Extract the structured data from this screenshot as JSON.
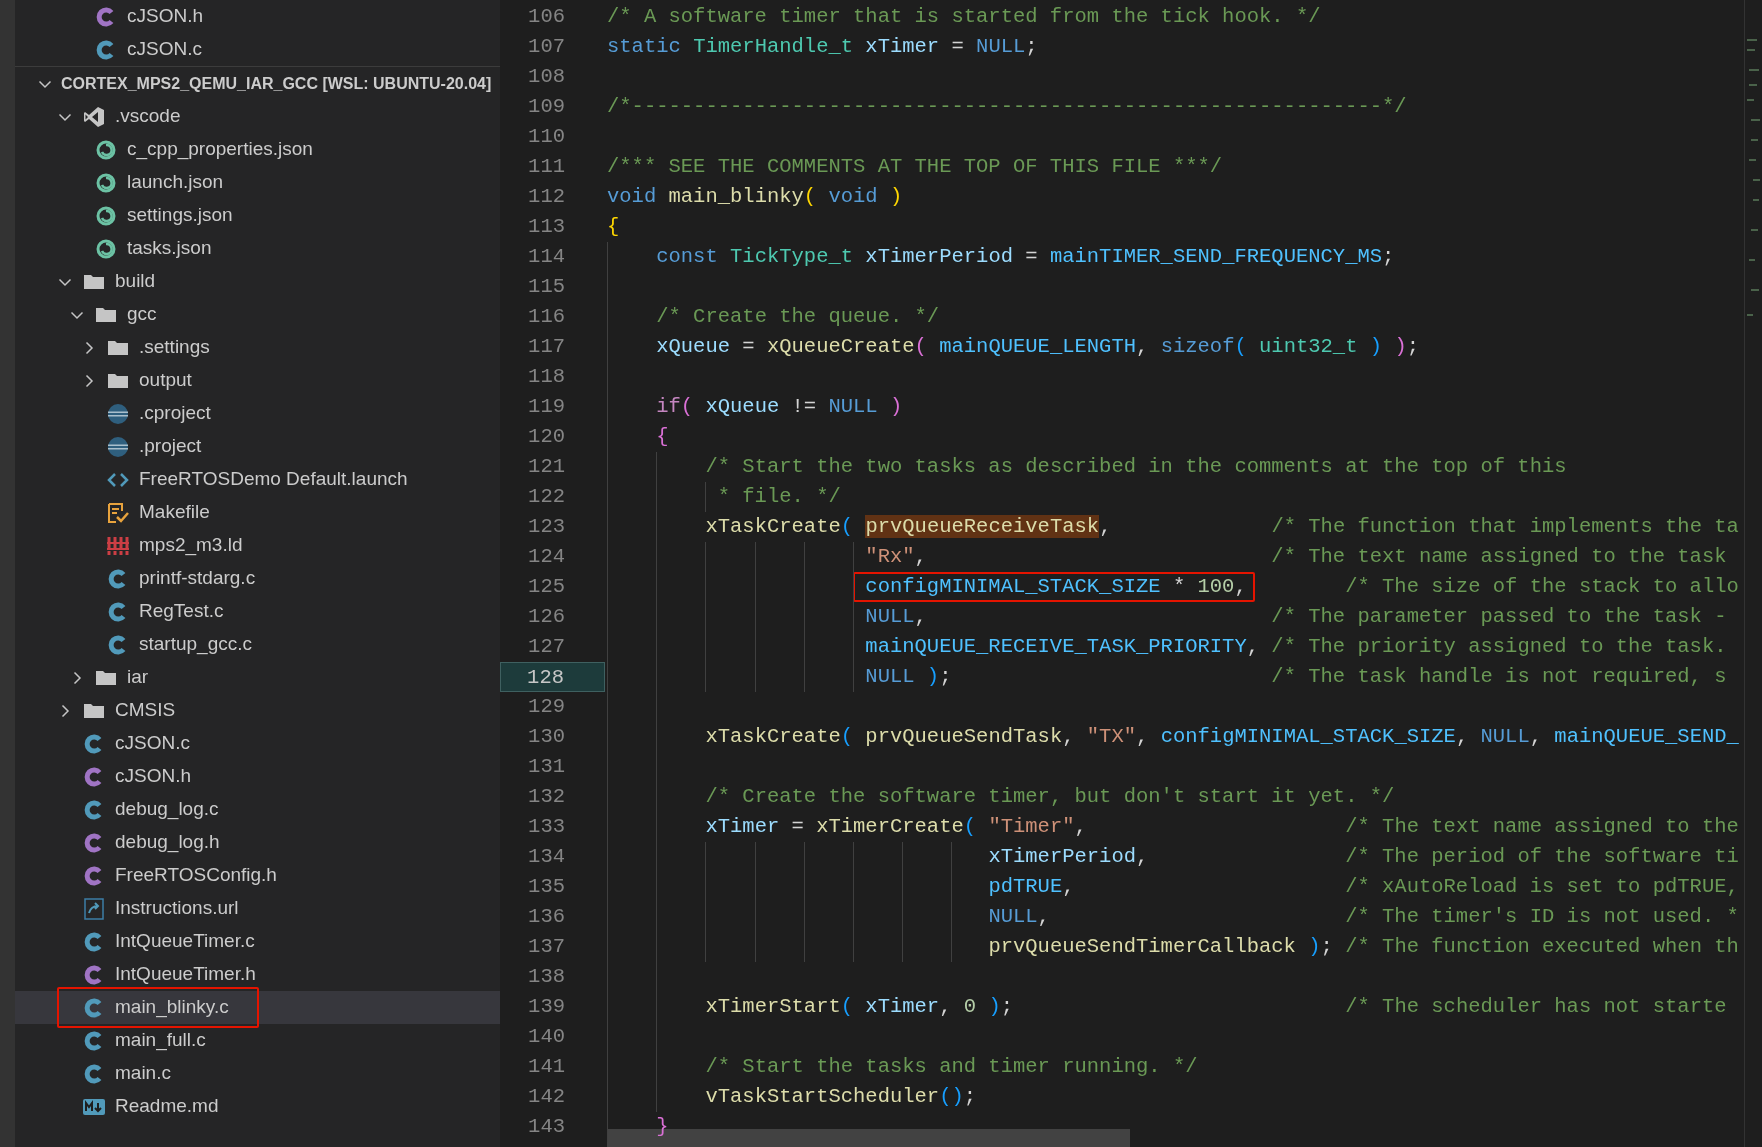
{
  "explorer": {
    "previous_items": [
      {
        "label": "cJSON.h",
        "kind": "c-header",
        "selected": false,
        "outlined": false
      },
      {
        "label": "cJSON.c",
        "kind": "c-source",
        "selected": false,
        "outlined": false
      }
    ],
    "workspace": {
      "title": "CORTEX_MPS2_QEMU_IAR_GCC [WSL: UBUNTU-20.04]",
      "expanded": true,
      "children": [
        {
          "label": ".vscode",
          "kind": "vscode",
          "expanded": true,
          "selected": false,
          "outlined": false,
          "children": [
            {
              "label": "c_cpp_properties.json",
              "kind": "json",
              "selected": false,
              "outlined": false
            },
            {
              "label": "launch.json",
              "kind": "json",
              "selected": false,
              "outlined": false
            },
            {
              "label": "settings.json",
              "kind": "json",
              "selected": false,
              "outlined": false
            },
            {
              "label": "tasks.json",
              "kind": "json",
              "selected": false,
              "outlined": false
            }
          ]
        },
        {
          "label": "build",
          "kind": "folder",
          "expanded": true,
          "selected": false,
          "outlined": false,
          "children": [
            {
              "label": "gcc",
              "kind": "folder",
              "expanded": true,
              "selected": false,
              "outlined": false,
              "children": [
                {
                  "label": ".settings",
                  "kind": "folder",
                  "expanded": false,
                  "selected": false,
                  "outlined": false
                },
                {
                  "label": "output",
                  "kind": "folder",
                  "expanded": false,
                  "selected": false,
                  "outlined": false
                },
                {
                  "label": ".cproject",
                  "kind": "eclipse",
                  "selected": false,
                  "outlined": false
                },
                {
                  "label": ".project",
                  "kind": "eclipse",
                  "selected": false,
                  "outlined": false
                },
                {
                  "label": "FreeRTOSDemo Default.launch",
                  "kind": "launch",
                  "selected": false,
                  "outlined": false
                },
                {
                  "label": "Makefile",
                  "kind": "makefile",
                  "selected": false,
                  "outlined": false
                },
                {
                  "label": "mps2_m3.ld",
                  "kind": "linker",
                  "selected": false,
                  "outlined": false
                },
                {
                  "label": "printf-stdarg.c",
                  "kind": "c-source",
                  "selected": false,
                  "outlined": false
                },
                {
                  "label": "RegTest.c",
                  "kind": "c-source",
                  "selected": false,
                  "outlined": false
                },
                {
                  "label": "startup_gcc.c",
                  "kind": "c-source",
                  "selected": false,
                  "outlined": false
                }
              ]
            },
            {
              "label": "iar",
              "kind": "folder",
              "expanded": false,
              "selected": false,
              "outlined": false
            }
          ]
        },
        {
          "label": "CMSIS",
          "kind": "folder",
          "expanded": false,
          "selected": false,
          "outlined": false
        },
        {
          "label": "cJSON.c",
          "kind": "c-source",
          "selected": false,
          "outlined": false
        },
        {
          "label": "cJSON.h",
          "kind": "c-header",
          "selected": false,
          "outlined": false
        },
        {
          "label": "debug_log.c",
          "kind": "c-source",
          "selected": false,
          "outlined": false
        },
        {
          "label": "debug_log.h",
          "kind": "c-header",
          "selected": false,
          "outlined": false
        },
        {
          "label": "FreeRTOSConfig.h",
          "kind": "c-header",
          "selected": false,
          "outlined": false
        },
        {
          "label": "Instructions.url",
          "kind": "url",
          "selected": false,
          "outlined": false
        },
        {
          "label": "IntQueueTimer.c",
          "kind": "c-source",
          "selected": false,
          "outlined": false
        },
        {
          "label": "IntQueueTimer.h",
          "kind": "c-header",
          "selected": false,
          "outlined": false
        },
        {
          "label": "main_blinky.c",
          "kind": "c-source",
          "selected": true,
          "outlined": true
        },
        {
          "label": "main_full.c",
          "kind": "c-source",
          "selected": false,
          "outlined": false
        },
        {
          "label": "main.c",
          "kind": "c-source",
          "selected": false,
          "outlined": false
        },
        {
          "label": "Readme.md",
          "kind": "markdown",
          "selected": false,
          "outlined": false
        }
      ]
    }
  },
  "editor": {
    "lines": [
      {
        "number": "106",
        "current": false,
        "tokens": [
          {
            "text": "/* A software timer that is started from the tick hook. */",
            "kind": "comment"
          }
        ]
      },
      {
        "number": "107",
        "current": false,
        "tokens": [
          {
            "text": "static ",
            "kind": "keyword"
          },
          {
            "text": "TimerHandle_t ",
            "kind": "type"
          },
          {
            "text": "xTimer ",
            "kind": "variable"
          },
          {
            "text": "= ",
            "kind": "punct"
          },
          {
            "text": "NULL",
            "kind": "keyword"
          },
          {
            "text": ";",
            "kind": "punct"
          }
        ]
      },
      {
        "number": "108",
        "current": false
      },
      {
        "number": "109",
        "current": false,
        "tokens": [
          {
            "text": "/*-------------------------------------------------------------*/",
            "kind": "comment"
          }
        ]
      },
      {
        "number": "110",
        "current": false
      },
      {
        "number": "111",
        "current": false,
        "tokens": [
          {
            "text": "/*** SEE THE COMMENTS AT THE TOP OF THIS FILE ***/",
            "kind": "comment"
          }
        ]
      },
      {
        "number": "112",
        "current": false,
        "tokens": [
          {
            "text": "void ",
            "kind": "keyword"
          },
          {
            "text": "main_blinky",
            "kind": "function"
          },
          {
            "text": "( ",
            "kind": "bracket1"
          },
          {
            "text": "void ",
            "kind": "keyword"
          },
          {
            "text": ")",
            "kind": "bracket1"
          }
        ]
      },
      {
        "number": "113",
        "current": false,
        "tokens": [
          {
            "text": "{",
            "kind": "bracket1"
          }
        ]
      },
      {
        "number": "114",
        "current": false,
        "tokens": [
          {
            "text": "    const ",
            "kind": "keyword"
          },
          {
            "text": "TickType_t ",
            "kind": "type"
          },
          {
            "text": "xTimerPeriod ",
            "kind": "variable"
          },
          {
            "text": "= ",
            "kind": "punct"
          },
          {
            "text": "mainTIMER_SEND_FREQUENCY_MS",
            "kind": "macro"
          },
          {
            "text": ";",
            "kind": "punct"
          }
        ]
      },
      {
        "number": "115",
        "current": false
      },
      {
        "number": "116",
        "current": false,
        "tokens": [
          {
            "text": "    /* Create the queue. */",
            "kind": "comment"
          }
        ]
      },
      {
        "number": "117",
        "current": false,
        "tokens": [
          {
            "text": "    xQueue ",
            "kind": "variable"
          },
          {
            "text": "= ",
            "kind": "punct"
          },
          {
            "text": "xQueueCreate",
            "kind": "function"
          },
          {
            "text": "( ",
            "kind": "bracket2"
          },
          {
            "text": "mainQUEUE_LENGTH",
            "kind": "macro"
          },
          {
            "text": ", ",
            "kind": "punct"
          },
          {
            "text": "sizeof",
            "kind": "keyword"
          },
          {
            "text": "( ",
            "kind": "bracket3"
          },
          {
            "text": "uint32_t ",
            "kind": "type"
          },
          {
            "text": ") ",
            "kind": "bracket3"
          },
          {
            "text": ")",
            "kind": "bracket2"
          },
          {
            "text": ";",
            "kind": "punct"
          }
        ]
      },
      {
        "number": "118",
        "current": false
      },
      {
        "number": "119",
        "current": false,
        "tokens": [
          {
            "text": "    if",
            "kind": "control"
          },
          {
            "text": "( ",
            "kind": "bracket2"
          },
          {
            "text": "xQueue ",
            "kind": "variable"
          },
          {
            "text": "!= ",
            "kind": "punct"
          },
          {
            "text": "NULL ",
            "kind": "keyword"
          },
          {
            "text": ")",
            "kind": "bracket2"
          }
        ]
      },
      {
        "number": "120",
        "current": false,
        "tokens": [
          {
            "text": "    {",
            "kind": "bracket2"
          }
        ]
      },
      {
        "number": "121",
        "current": false,
        "tokens": [
          {
            "text": "        /* Start the two tasks as described in the comments at the top of this",
            "kind": "comment"
          }
        ]
      },
      {
        "number": "122",
        "current": false,
        "tokens": [
          {
            "text": "         * file. */",
            "kind": "comment"
          }
        ]
      },
      {
        "number": "123",
        "current": false,
        "tokens": [
          {
            "text": "        xTaskCreate",
            "kind": "function"
          },
          {
            "text": "( ",
            "kind": "bracket3"
          },
          {
            "text": "prvQueueReceiveTask",
            "kind": "search_match"
          },
          {
            "text": ",             ",
            "kind": "punct"
          },
          {
            "text": "/* The function that implements the ta",
            "kind": "comment"
          }
        ]
      },
      {
        "number": "124",
        "current": false,
        "tokens": [
          {
            "text": "                     \"Rx\"",
            "kind": "string"
          },
          {
            "text": ",                            ",
            "kind": "punct"
          },
          {
            "text": "/* The text name assigned to the task",
            "kind": "comment"
          }
        ]
      },
      {
        "number": "125",
        "current": false,
        "tokens": [
          {
            "kind": "annotation",
            "parts": [
              {
                "text": "                     configMINIMAL_STACK_SIZE",
                "kind": "macro"
              },
              {
                "text": " * ",
                "kind": "punct"
              },
              {
                "text": "100",
                "kind": "number"
              },
              {
                "text": ",",
                "kind": "punct"
              }
            ]
          },
          {
            "text": "        /* The size of the stack to allo",
            "kind": "comment"
          }
        ]
      },
      {
        "number": "126",
        "current": false,
        "tokens": [
          {
            "text": "                     NULL",
            "kind": "keyword"
          },
          {
            "text": ",                            ",
            "kind": "punct"
          },
          {
            "text": "/* The parameter passed to the task -",
            "kind": "comment"
          }
        ]
      },
      {
        "number": "127",
        "current": false,
        "tokens": [
          {
            "text": "                     mainQUEUE_RECEIVE_TASK_PRIORITY",
            "kind": "macro"
          },
          {
            "text": ", ",
            "kind": "punct"
          },
          {
            "text": "/* The priority assigned to the task.",
            "kind": "comment"
          }
        ]
      },
      {
        "number": "128",
        "current": true,
        "tokens": [
          {
            "text": "                     NULL ",
            "kind": "keyword"
          },
          {
            "text": ")",
            "kind": "bracket3"
          },
          {
            "text": ";                          ",
            "kind": "punct"
          },
          {
            "text": "/* The task handle is not required, s",
            "kind": "comment"
          }
        ]
      },
      {
        "number": "129",
        "current": false
      },
      {
        "number": "130",
        "current": false,
        "tokens": [
          {
            "text": "        xTaskCreate",
            "kind": "function"
          },
          {
            "text": "( ",
            "kind": "bracket3"
          },
          {
            "text": "prvQueueSendTask",
            "kind": "function"
          },
          {
            "text": ", ",
            "kind": "punct"
          },
          {
            "text": "\"TX\"",
            "kind": "string"
          },
          {
            "text": ", ",
            "kind": "punct"
          },
          {
            "text": "configMINIMAL_STACK_SIZE",
            "kind": "macro"
          },
          {
            "text": ", ",
            "kind": "punct"
          },
          {
            "text": "NULL",
            "kind": "keyword"
          },
          {
            "text": ", ",
            "kind": "punct"
          },
          {
            "text": "mainQUEUE_SEND_",
            "kind": "macro"
          }
        ]
      },
      {
        "number": "131",
        "current": false
      },
      {
        "number": "132",
        "current": false,
        "tokens": [
          {
            "text": "        /* Create the software timer, but don't start it yet. */",
            "kind": "comment"
          }
        ]
      },
      {
        "number": "133",
        "current": false,
        "tokens": [
          {
            "text": "        xTimer ",
            "kind": "variable"
          },
          {
            "text": "= ",
            "kind": "punct"
          },
          {
            "text": "xTimerCreate",
            "kind": "function"
          },
          {
            "text": "( ",
            "kind": "bracket3"
          },
          {
            "text": "\"Timer\"",
            "kind": "string"
          },
          {
            "text": ",                     ",
            "kind": "punct"
          },
          {
            "text": "/* The text name assigned to the",
            "kind": "comment"
          }
        ]
      },
      {
        "number": "134",
        "current": false,
        "tokens": [
          {
            "text": "                               xTimerPeriod",
            "kind": "variable"
          },
          {
            "text": ",                ",
            "kind": "punct"
          },
          {
            "text": "/* The period of the software ti",
            "kind": "comment"
          }
        ]
      },
      {
        "number": "135",
        "current": false,
        "tokens": [
          {
            "text": "                               pdTRUE",
            "kind": "macro"
          },
          {
            "text": ",                      ",
            "kind": "punct"
          },
          {
            "text": "/* xAutoReload is set to pdTRUE,",
            "kind": "comment"
          }
        ]
      },
      {
        "number": "136",
        "current": false,
        "tokens": [
          {
            "text": "                               NULL",
            "kind": "keyword"
          },
          {
            "text": ",                        ",
            "kind": "punct"
          },
          {
            "text": "/* The timer's ID is not used. *",
            "kind": "comment"
          }
        ]
      },
      {
        "number": "137",
        "current": false,
        "tokens": [
          {
            "text": "                               prvQueueSendTimerCallback ",
            "kind": "function"
          },
          {
            "text": ")",
            "kind": "bracket3"
          },
          {
            "text": "; ",
            "kind": "punct"
          },
          {
            "text": "/* The function executed when th",
            "kind": "comment"
          }
        ]
      },
      {
        "number": "138",
        "current": false
      },
      {
        "number": "139",
        "current": false,
        "tokens": [
          {
            "text": "        xTimerStart",
            "kind": "function"
          },
          {
            "text": "( ",
            "kind": "bracket3"
          },
          {
            "text": "xTimer",
            "kind": "variable"
          },
          {
            "text": ", ",
            "kind": "punct"
          },
          {
            "text": "0 ",
            "kind": "number"
          },
          {
            "text": ")",
            "kind": "bracket3"
          },
          {
            "text": ";                           ",
            "kind": "punct"
          },
          {
            "text": "/* The scheduler has not starte",
            "kind": "comment"
          }
        ]
      },
      {
        "number": "140",
        "current": false
      },
      {
        "number": "141",
        "current": false,
        "tokens": [
          {
            "text": "        /* Start the tasks and timer running. */",
            "kind": "comment"
          }
        ]
      },
      {
        "number": "142",
        "current": false,
        "tokens": [
          {
            "text": "        vTaskStartScheduler",
            "kind": "function"
          },
          {
            "text": "()",
            "kind": "bracket3"
          },
          {
            "text": ";",
            "kind": "punct"
          }
        ]
      },
      {
        "number": "143",
        "current": false,
        "tokens": [
          {
            "text": "    }",
            "kind": "bracket2"
          }
        ]
      }
    ]
  }
}
